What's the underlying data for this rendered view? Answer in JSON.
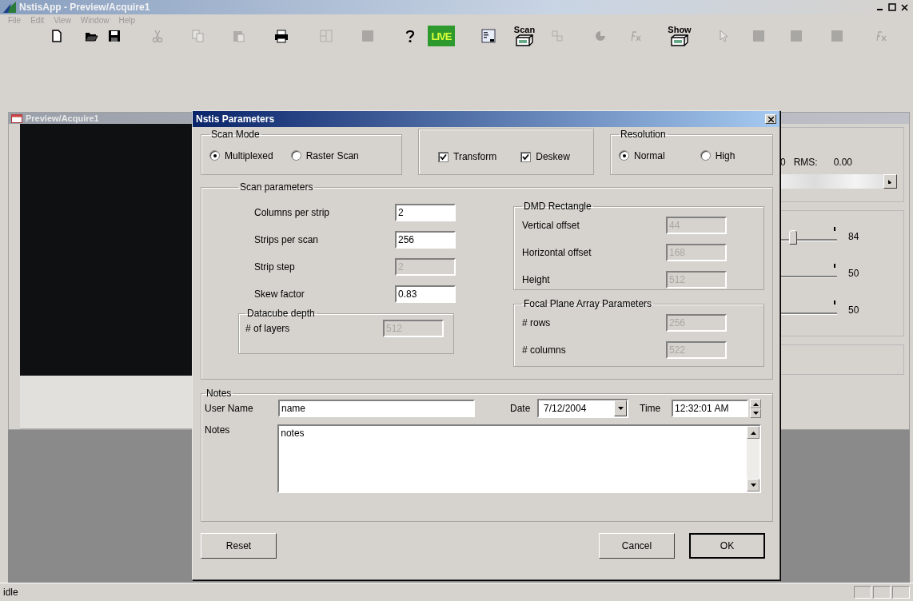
{
  "app": {
    "title": "NstisApp - Preview/Acquire1"
  },
  "menu": [
    "File",
    "Edit",
    "View",
    "Window",
    "Help"
  ],
  "toolbar": [
    {
      "disabled": false
    },
    {
      "disabled": false
    },
    {
      "disabled": false
    },
    {
      "disabled": true
    },
    {
      "disabled": true
    },
    {
      "disabled": true
    },
    {
      "disabled": false
    },
    {
      "disabled": true
    },
    {
      "disabled": true
    },
    {
      "disabled": false
    },
    {
      "disabled": false,
      "label": "LIVE"
    },
    {
      "disabled": false
    },
    {
      "disabled": false,
      "label": "Scan"
    },
    {
      "disabled": true
    },
    {
      "disabled": true
    },
    {
      "disabled": true
    },
    {
      "disabled": false,
      "label": "Show"
    },
    {
      "disabled": true
    },
    {
      "disabled": true
    },
    {
      "disabled": true
    },
    {
      "disabled": true
    },
    {
      "disabled": true
    }
  ],
  "child_window": {
    "title": "Preview/Acquire1",
    "rms_prefix": "0",
    "rms_label": "RMS:",
    "rms_value": "0.00",
    "sliders": [
      {
        "reading": "84"
      },
      {
        "reading": "50"
      },
      {
        "reading": "50"
      }
    ]
  },
  "dialog": {
    "title": "Nstis Parameters",
    "scan_mode": {
      "label": "Scan Mode",
      "options": [
        {
          "label": "Multiplexed",
          "selected": true
        },
        {
          "label": "Raster Scan",
          "selected": false
        }
      ]
    },
    "options": [
      {
        "label": "Transform",
        "checked": true
      },
      {
        "label": "Deskew",
        "checked": true
      }
    ],
    "resolution": {
      "label": "Resolution",
      "options": [
        {
          "label": "Normal",
          "selected": true
        },
        {
          "label": "High",
          "selected": false
        }
      ]
    },
    "scan_parameters": {
      "label": "Scan parameters",
      "fields": [
        {
          "label": "Columns per strip",
          "value": "2",
          "disabled": false
        },
        {
          "label": "Strips per scan",
          "value": "256",
          "disabled": false
        },
        {
          "label": "Strip step",
          "value": "2",
          "disabled": true
        },
        {
          "label": "Skew factor",
          "value": "0.83",
          "disabled": false
        }
      ],
      "datacube": {
        "label": "Datacube depth",
        "fields": [
          {
            "label": "# of layers",
            "value": "512",
            "disabled": true
          }
        ]
      },
      "dmd": {
        "label": "DMD Rectangle",
        "fields": [
          {
            "label": "Vertical offset",
            "value": "44",
            "disabled": true
          },
          {
            "label": "Horizontal offset",
            "value": "168",
            "disabled": true
          },
          {
            "label": "Height",
            "value": "512",
            "disabled": true
          }
        ]
      },
      "focal_plane": {
        "label": "Focal Plane Array Parameters",
        "fields": [
          {
            "label": "# rows",
            "value": "256",
            "disabled": true
          },
          {
            "label": "# columns",
            "value": "522",
            "disabled": true
          }
        ]
      }
    },
    "notes": {
      "label": "Notes",
      "user_name_label": "User Name",
      "user_name": "name",
      "date_label": "Date",
      "date": "7/12/2004",
      "time_label": "Time",
      "time": "12:32:01 AM",
      "notes_label": "Notes",
      "notes": "notes"
    },
    "buttons": [
      {
        "label": "Reset",
        "default": false
      },
      {
        "label": "Cancel",
        "default": false
      },
      {
        "label": "OK",
        "default": true
      }
    ]
  },
  "status_bar": {
    "text": "idle"
  }
}
